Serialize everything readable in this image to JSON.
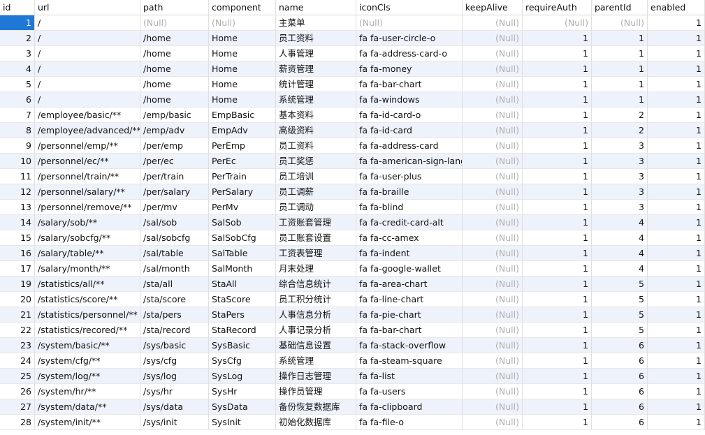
{
  "columns": [
    "id",
    "url",
    "path",
    "component",
    "name",
    "iconCls",
    "keepAlive",
    "requireAuth",
    "parentId",
    "enabled"
  ],
  "null_text": "(Null)",
  "rows": [
    {
      "id": "1",
      "url": "/",
      "path": "(Null)",
      "component": "(Null)",
      "name": "主菜单",
      "iconCls": "(Null)",
      "keepAlive": "(Null)",
      "requireAuth": "(Null)",
      "parentId": "(Null)",
      "enabled": "1"
    },
    {
      "id": "2",
      "url": "/",
      "path": "/home",
      "component": "Home",
      "name": "员工资料",
      "iconCls": "fa fa-user-circle-o",
      "keepAlive": "(Null)",
      "requireAuth": "1",
      "parentId": "1",
      "enabled": "1"
    },
    {
      "id": "3",
      "url": "/",
      "path": "/home",
      "component": "Home",
      "name": "人事管理",
      "iconCls": "fa fa-address-card-o",
      "keepAlive": "(Null)",
      "requireAuth": "1",
      "parentId": "1",
      "enabled": "1"
    },
    {
      "id": "4",
      "url": "/",
      "path": "/home",
      "component": "Home",
      "name": "薪资管理",
      "iconCls": "fa fa-money",
      "keepAlive": "(Null)",
      "requireAuth": "1",
      "parentId": "1",
      "enabled": "1"
    },
    {
      "id": "5",
      "url": "/",
      "path": "/home",
      "component": "Home",
      "name": "统计管理",
      "iconCls": "fa fa-bar-chart",
      "keepAlive": "(Null)",
      "requireAuth": "1",
      "parentId": "1",
      "enabled": "1"
    },
    {
      "id": "6",
      "url": "/",
      "path": "/home",
      "component": "Home",
      "name": "系统管理",
      "iconCls": "fa fa-windows",
      "keepAlive": "(Null)",
      "requireAuth": "1",
      "parentId": "1",
      "enabled": "1"
    },
    {
      "id": "7",
      "url": "/employee/basic/**",
      "path": "/emp/basic",
      "component": "EmpBasic",
      "name": "基本资料",
      "iconCls": "fa fa-id-card-o",
      "keepAlive": "(Null)",
      "requireAuth": "1",
      "parentId": "2",
      "enabled": "1"
    },
    {
      "id": "8",
      "url": "/employee/advanced/**",
      "path": "/emp/adv",
      "component": "EmpAdv",
      "name": "高级资料",
      "iconCls": "fa fa-id-card",
      "keepAlive": "(Null)",
      "requireAuth": "1",
      "parentId": "2",
      "enabled": "1"
    },
    {
      "id": "9",
      "url": "/personnel/emp/**",
      "path": "/per/emp",
      "component": "PerEmp",
      "name": "员工资料",
      "iconCls": "fa fa-address-card",
      "keepAlive": "(Null)",
      "requireAuth": "1",
      "parentId": "3",
      "enabled": "1"
    },
    {
      "id": "10",
      "url": "/personnel/ec/**",
      "path": "/per/ec",
      "component": "PerEc",
      "name": "员工奖惩",
      "iconCls": "fa fa-american-sign-langu",
      "keepAlive": "(Null)",
      "requireAuth": "1",
      "parentId": "3",
      "enabled": "1"
    },
    {
      "id": "11",
      "url": "/personnel/train/**",
      "path": "/per/train",
      "component": "PerTrain",
      "name": "员工培训",
      "iconCls": "fa fa-user-plus",
      "keepAlive": "(Null)",
      "requireAuth": "1",
      "parentId": "3",
      "enabled": "1"
    },
    {
      "id": "12",
      "url": "/personnel/salary/**",
      "path": "/per/salary",
      "component": "PerSalary",
      "name": "员工调薪",
      "iconCls": "fa fa-braille",
      "keepAlive": "(Null)",
      "requireAuth": "1",
      "parentId": "3",
      "enabled": "1"
    },
    {
      "id": "13",
      "url": "/personnel/remove/**",
      "path": "/per/mv",
      "component": "PerMv",
      "name": "员工调动",
      "iconCls": "fa fa-blind",
      "keepAlive": "(Null)",
      "requireAuth": "1",
      "parentId": "3",
      "enabled": "1"
    },
    {
      "id": "14",
      "url": "/salary/sob/**",
      "path": "/sal/sob",
      "component": "SalSob",
      "name": "工资账套管理",
      "iconCls": "fa fa-credit-card-alt",
      "keepAlive": "(Null)",
      "requireAuth": "1",
      "parentId": "4",
      "enabled": "1"
    },
    {
      "id": "15",
      "url": "/salary/sobcfg/**",
      "path": "/sal/sobcfg",
      "component": "SalSobCfg",
      "name": "员工账套设置",
      "iconCls": "fa fa-cc-amex",
      "keepAlive": "(Null)",
      "requireAuth": "1",
      "parentId": "4",
      "enabled": "1"
    },
    {
      "id": "16",
      "url": "/salary/table/**",
      "path": "/sal/table",
      "component": "SalTable",
      "name": "工资表管理",
      "iconCls": "fa fa-indent",
      "keepAlive": "(Null)",
      "requireAuth": "1",
      "parentId": "4",
      "enabled": "1"
    },
    {
      "id": "17",
      "url": "/salary/month/**",
      "path": "/sal/month",
      "component": "SalMonth",
      "name": "月末处理",
      "iconCls": "fa fa-google-wallet",
      "keepAlive": "(Null)",
      "requireAuth": "1",
      "parentId": "4",
      "enabled": "1"
    },
    {
      "id": "19",
      "url": "/statistics/all/**",
      "path": "/sta/all",
      "component": "StaAll",
      "name": "综合信息统计",
      "iconCls": "fa fa-area-chart",
      "keepAlive": "(Null)",
      "requireAuth": "1",
      "parentId": "5",
      "enabled": "1"
    },
    {
      "id": "20",
      "url": "/statistics/score/**",
      "path": "/sta/score",
      "component": "StaScore",
      "name": "员工积分统计",
      "iconCls": "fa fa-line-chart",
      "keepAlive": "(Null)",
      "requireAuth": "1",
      "parentId": "5",
      "enabled": "1"
    },
    {
      "id": "21",
      "url": "/statistics/personnel/**",
      "path": "/sta/pers",
      "component": "StaPers",
      "name": "人事信息分析",
      "iconCls": "fa fa-pie-chart",
      "keepAlive": "(Null)",
      "requireAuth": "1",
      "parentId": "5",
      "enabled": "1"
    },
    {
      "id": "22",
      "url": "/statistics/recored/**",
      "path": "/sta/record",
      "component": "StaRecord",
      "name": "人事记录分析",
      "iconCls": "fa fa-bar-chart",
      "keepAlive": "(Null)",
      "requireAuth": "1",
      "parentId": "5",
      "enabled": "1"
    },
    {
      "id": "23",
      "url": "/system/basic/**",
      "path": "/sys/basic",
      "component": "SysBasic",
      "name": "基础信息设置",
      "iconCls": "fa fa-stack-overflow",
      "keepAlive": "(Null)",
      "requireAuth": "1",
      "parentId": "6",
      "enabled": "1"
    },
    {
      "id": "24",
      "url": "/system/cfg/**",
      "path": "/sys/cfg",
      "component": "SysCfg",
      "name": "系统管理",
      "iconCls": "fa fa-steam-square",
      "keepAlive": "(Null)",
      "requireAuth": "1",
      "parentId": "6",
      "enabled": "1"
    },
    {
      "id": "25",
      "url": "/system/log/**",
      "path": "/sys/log",
      "component": "SysLog",
      "name": "操作日志管理",
      "iconCls": "fa fa-list",
      "keepAlive": "(Null)",
      "requireAuth": "1",
      "parentId": "6",
      "enabled": "1"
    },
    {
      "id": "26",
      "url": "/system/hr/**",
      "path": "/sys/hr",
      "component": "SysHr",
      "name": "操作员管理",
      "iconCls": "fa fa-users",
      "keepAlive": "(Null)",
      "requireAuth": "1",
      "parentId": "6",
      "enabled": "1"
    },
    {
      "id": "27",
      "url": "/system/data/**",
      "path": "/sys/data",
      "component": "SysData",
      "name": "备份恢复数据库",
      "iconCls": "fa fa-clipboard",
      "keepAlive": "(Null)",
      "requireAuth": "1",
      "parentId": "6",
      "enabled": "1"
    },
    {
      "id": "28",
      "url": "/system/init/**",
      "path": "/sys/init",
      "component": "SysInit",
      "name": "初始化数据库",
      "iconCls": "fa fa-file-o",
      "keepAlive": "(Null)",
      "requireAuth": "1",
      "parentId": "6",
      "enabled": "1"
    }
  ]
}
